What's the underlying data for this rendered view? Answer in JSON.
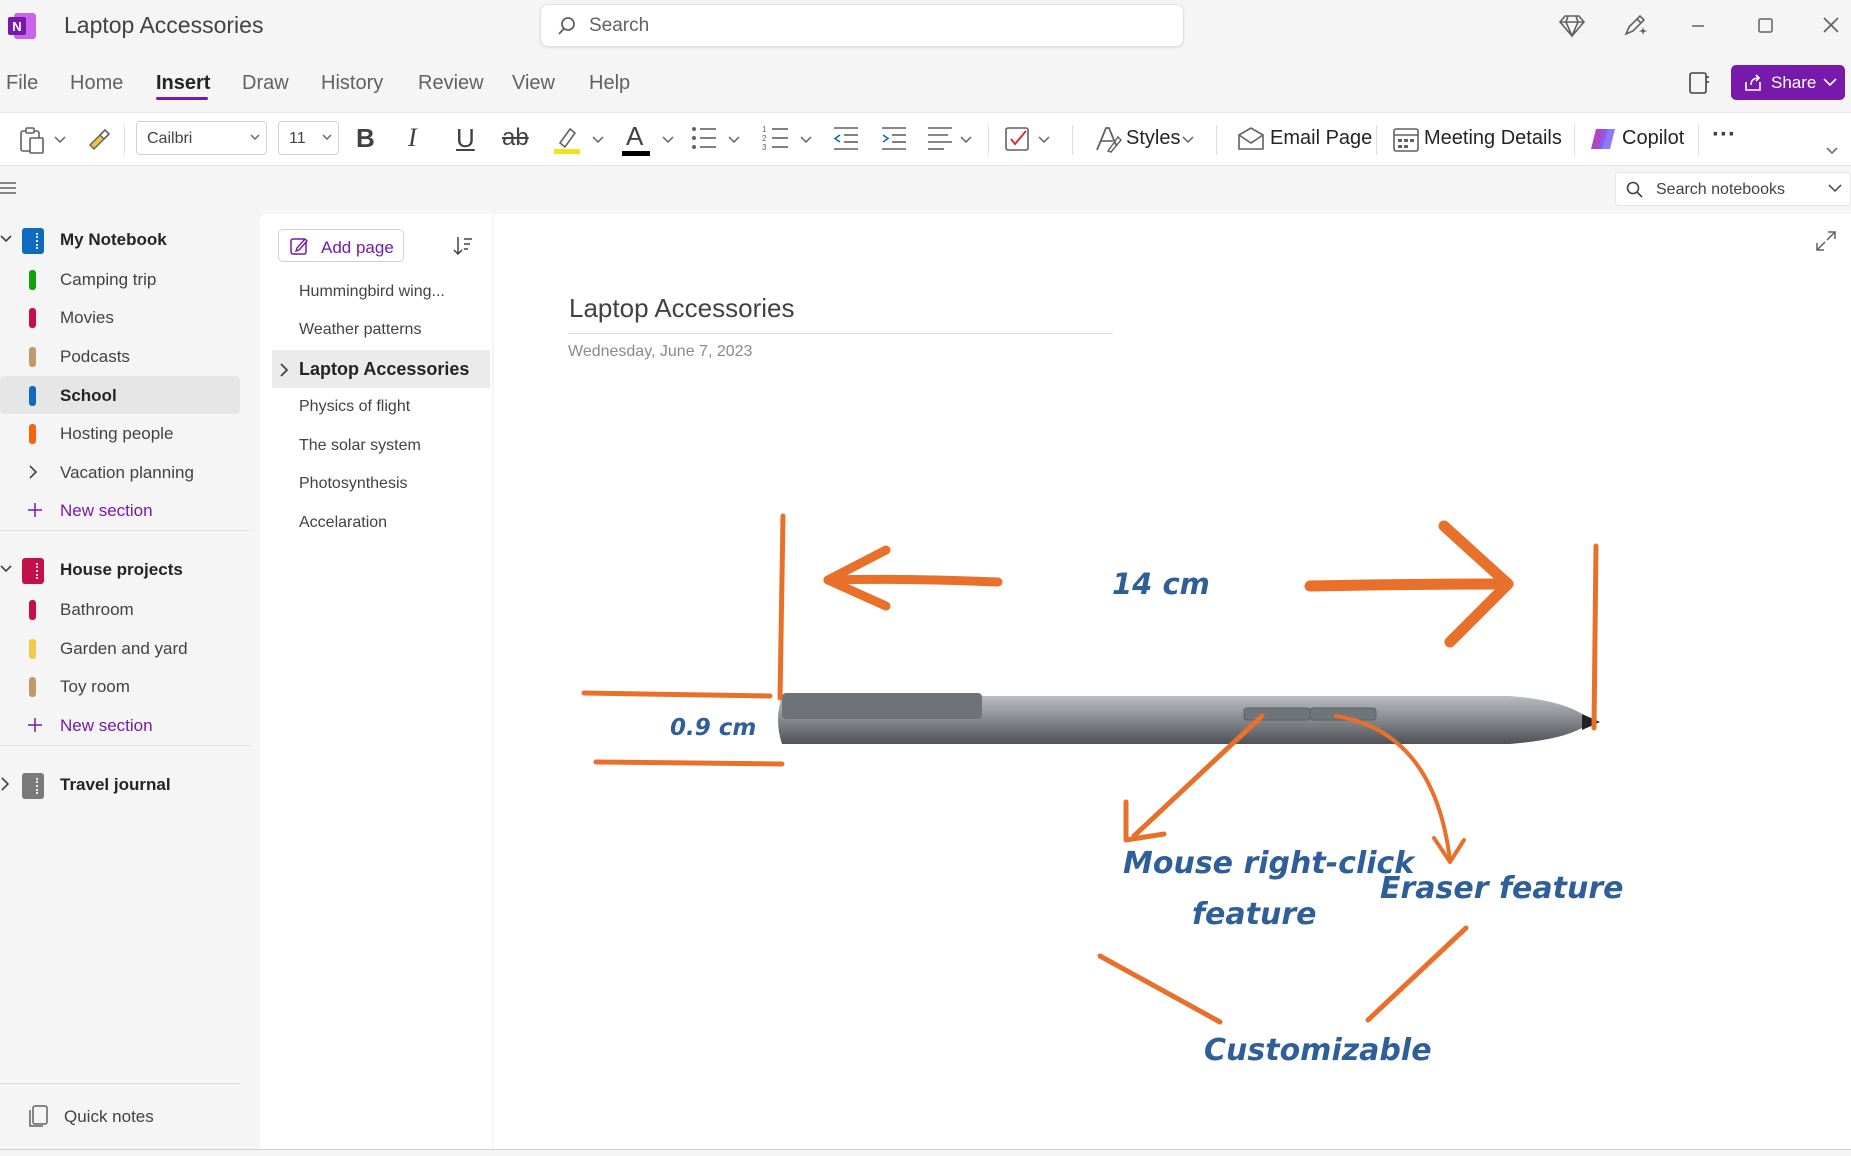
{
  "window": {
    "title": "Laptop Accessories",
    "search_placeholder": "Search"
  },
  "menu": {
    "tabs": [
      "File",
      "Home",
      "Insert",
      "Draw",
      "History",
      "Review",
      "View",
      "Help"
    ],
    "active_tab": "Insert",
    "share_label": "Share"
  },
  "ribbon": {
    "font_name": "Cailbri",
    "font_size": "11",
    "bold": "B",
    "italic": "I",
    "underline": "U",
    "strikethrough": "ab",
    "font_color_glyph": "A",
    "styles_label": "Styles",
    "email_page_label": "Email Page",
    "meeting_details_label": "Meeting Details",
    "copilot_label": "Copilot",
    "more": "···"
  },
  "notebook_search": {
    "placeholder": "Search notebooks"
  },
  "notebooks": [
    {
      "name": "My Notebook",
      "color": "#0f6cbd",
      "sections": [
        {
          "label": "Camping trip",
          "color": "#13a10e"
        },
        {
          "label": "Movies",
          "color": "#c50f4a"
        },
        {
          "label": "Podcasts",
          "color": "#c19a6b"
        },
        {
          "label": "School",
          "color": "#0f6cbd",
          "selected": true
        },
        {
          "label": "Hosting people",
          "color": "#f7630c"
        },
        {
          "label": "Vacation planning",
          "group": true
        }
      ],
      "new_section": "New section"
    },
    {
      "name": "House projects",
      "color": "#c50f4a",
      "sections": [
        {
          "label": "Bathroom",
          "color": "#c50f4a"
        },
        {
          "label": "Garden and yard",
          "color": "#f2c94c"
        },
        {
          "label": "Toy room",
          "color": "#c19a6b"
        }
      ],
      "new_section": "New section"
    },
    {
      "name": "Travel journal",
      "color": "#7a7a7a",
      "collapsed": true
    }
  ],
  "quick_notes": "Quick notes",
  "pages": {
    "add_page": "Add page",
    "items": [
      "Hummingbird wing...",
      "Weather patterns",
      "Laptop Accessories",
      "Physics of flight",
      "The solar system",
      "Photosynthesis",
      "Accelaration"
    ],
    "selected": "Laptop Accessories"
  },
  "note": {
    "title": "Laptop Accessories",
    "date": "Wednesday, June 7, 2023",
    "annotations": {
      "length": "14 cm",
      "width": "0.9 cm",
      "right_click": [
        "Mouse right-click",
        "feature"
      ],
      "eraser": "Eraser feature",
      "customizable": "Customizable"
    }
  },
  "colors": {
    "accent": "#7719aa",
    "ink_orange": "#e8702a",
    "ink_blue": "#2f5f98"
  }
}
